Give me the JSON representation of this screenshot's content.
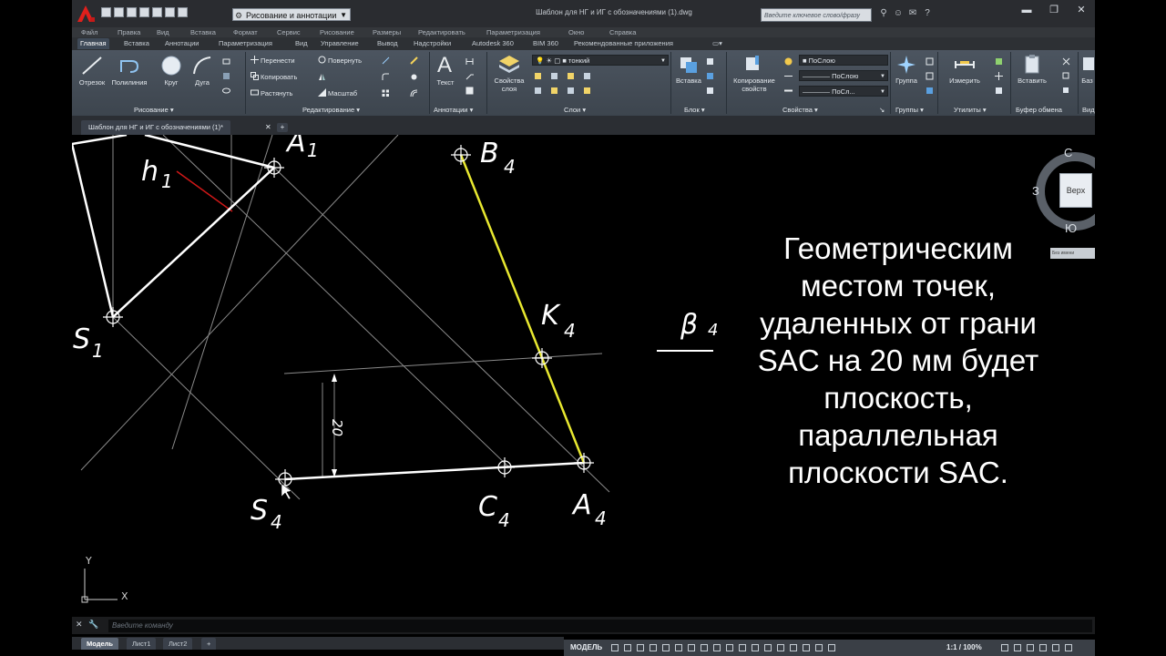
{
  "window": {
    "title": "Шаблон для НГ и ИГ с обозначениями (1).dwg",
    "workspace": "Рисование и аннотации",
    "search_placeholder": "Введите ключевое слово/фразу"
  },
  "menu": [
    "Файл",
    "Правка",
    "Вид",
    "Вставка",
    "Формат",
    "Сервис",
    "Рисование",
    "Размеры",
    "Редактировать",
    "Параметризация",
    "Окно",
    "Справка"
  ],
  "ribbon_tabs": [
    "Главная",
    "Вставка",
    "Аннотации",
    "Параметризация",
    "Вид",
    "Управление",
    "Вывод",
    "Надстройки",
    "Autodesk 360",
    "BIM 360",
    "Рекомендованные приложения"
  ],
  "ribbon": {
    "draw": {
      "title": "Рисование",
      "line": "Отрезок",
      "polyline": "Полилиния",
      "circle": "Круг",
      "arc": "Дуга"
    },
    "modify": {
      "title": "Редактирование",
      "move": "Перенести",
      "rotate": "Повернуть",
      "copy": "Копировать",
      "mirror": "",
      "stretch": "Растянуть",
      "scale": "Масштаб"
    },
    "annotation": {
      "title": "Аннотации",
      "text": "Текст"
    },
    "layers": {
      "title": "Слои",
      "props": "Свойства слоя",
      "current_layer": "тонкий"
    },
    "block": {
      "title": "Блок",
      "insert": "Вставка"
    },
    "properties": {
      "title": "Свойства",
      "match": "Копирование свойств",
      "color": "ПоСлою",
      "linetype": "ПоСлою",
      "lineweight": "ПоСл..."
    },
    "groups": {
      "title": "Группы",
      "group": "Группа"
    },
    "utilities": {
      "title": "Утилиты",
      "measure": "Измерить"
    },
    "clipboard": {
      "title": "Буфер обмена",
      "paste": "Вставить"
    },
    "extra1": "Баз",
    "extra2": "Вид"
  },
  "doc_tab": "Шаблон для НГ и ИГ с обозначениями (1)*",
  "drawing": {
    "labels": {
      "A1": "A",
      "A1_sub": "1",
      "h1": "h",
      "h1_sub": "1",
      "S1": "S",
      "S1_sub": "1",
      "B4": "B",
      "B4_sub": "4",
      "K4": "K",
      "K4_sub": "4",
      "S4": "S",
      "S4_sub": "4",
      "C4": "C",
      "C4_sub": "4",
      "A4": "A",
      "A4_sub": "4",
      "beta4": "β",
      "beta4_sub": "4",
      "dimension": "20",
      "ucs_x": "X",
      "ucs_y": "Y"
    },
    "annotation_text": "Геометрическим местом точек, удаленных от грани SAC на 20 мм будет плоскость, параллельная плоскости SAC."
  },
  "viewcube": {
    "north": "С",
    "south": "Ю",
    "west": "З",
    "face": "Верх",
    "wcs": "Без имени"
  },
  "command_line": {
    "placeholder": "Введите команду"
  },
  "layout_tabs": [
    "Модель",
    "Лист1",
    "Лист2"
  ],
  "statusbar": {
    "model": "МОДЕЛЬ",
    "scale": "1:1 / 100%"
  },
  "colors": {
    "background": "#000000",
    "yellow_edge": "#e8e830",
    "red_line": "#d01818",
    "ribbon": "#454d57"
  }
}
